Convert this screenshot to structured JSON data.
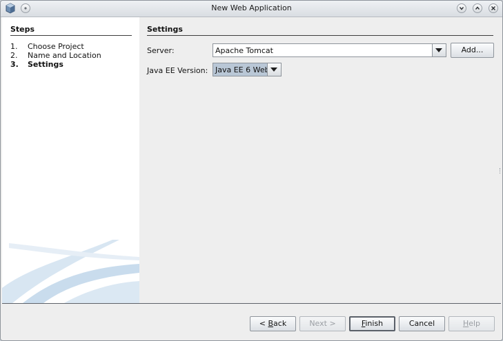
{
  "window": {
    "title": "New Web Application",
    "icons": [
      "app-cube-icon",
      "menu-dot-icon",
      "minimize-icon",
      "maximize-icon",
      "close-icon"
    ]
  },
  "steps": {
    "heading": "Steps",
    "items": [
      {
        "num": "1.",
        "label": "Choose Project"
      },
      {
        "num": "2.",
        "label": "Name and Location"
      },
      {
        "num": "3.",
        "label": "Settings"
      }
    ],
    "current": 2
  },
  "settings": {
    "heading": "Settings",
    "server_label": "Server:",
    "server_value": "Apache Tomcat",
    "add_button": "Add...",
    "javaee_label_mnemonic": "J",
    "javaee_label_rest": "ava EE Version:",
    "javaee_value": "Java EE 6 Web"
  },
  "buttons": {
    "back_prefix": "< ",
    "back_mn": "B",
    "back_rest": "ack",
    "next": "Next >",
    "finish_mn": "F",
    "finish_rest": "inish",
    "cancel": "Cancel",
    "help_mn": "H",
    "help_rest": "elp"
  },
  "colors": {
    "selected_combo": "#b9c7d6",
    "window_bg": "#eeeeee",
    "steps_bg": "#ffffff",
    "swoosh": "#c9dced"
  }
}
